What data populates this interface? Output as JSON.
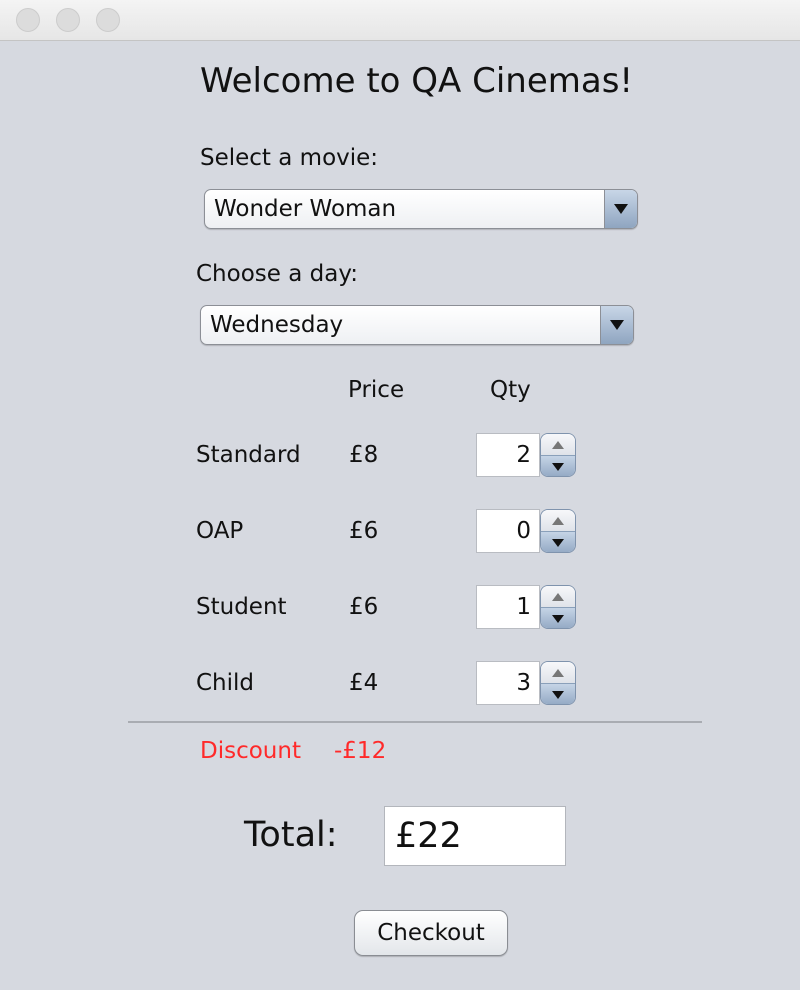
{
  "window": {
    "traffic_lights": [
      "close",
      "minimize",
      "zoom"
    ]
  },
  "app": {
    "heading": "Welcome to QA Cinemas!"
  },
  "movie": {
    "label": "Select a movie:",
    "selected": "Wonder Woman"
  },
  "day": {
    "label": "Choose a day:",
    "selected": "Wednesday"
  },
  "tickets": {
    "price_header": "Price",
    "qty_header": "Qty",
    "rows": [
      {
        "type": "Standard",
        "price": "£8",
        "qty": "2"
      },
      {
        "type": "OAP",
        "price": "£6",
        "qty": "0"
      },
      {
        "type": "Student",
        "price": "£6",
        "qty": "1"
      },
      {
        "type": "Child",
        "price": "£4",
        "qty": "3"
      }
    ]
  },
  "discount": {
    "label": "Discount",
    "value": "-£12",
    "color": "#ff2a2a"
  },
  "total": {
    "label": "Total:",
    "value": "£22"
  },
  "checkout": {
    "label": "Checkout"
  }
}
